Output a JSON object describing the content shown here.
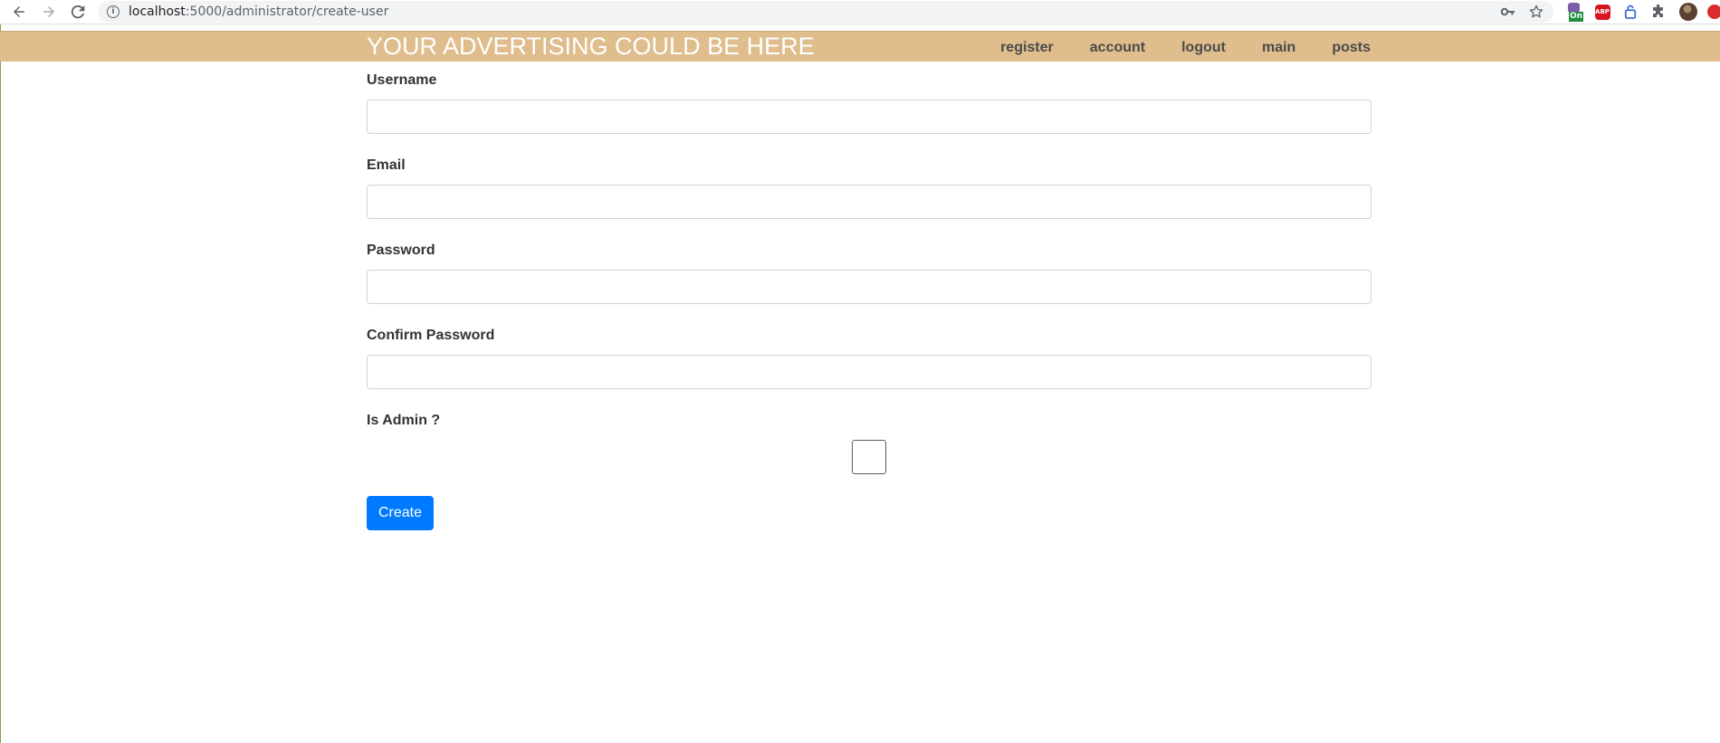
{
  "browser": {
    "url_host": "localhost",
    "url_path": ":5000/administrator/create-user",
    "extensions": {
      "on_badge": "On",
      "abp_label": "ABP"
    },
    "icons": [
      "back-arrow-icon",
      "forward-arrow-icon",
      "reload-icon",
      "info-icon",
      "key-icon",
      "star-icon",
      "puzzle-icon",
      "avatar",
      "extension-icon"
    ]
  },
  "header": {
    "brand": "YOUR ADVERTISING COULD BE HERE",
    "background_color": "#dfbd8c",
    "nav": [
      {
        "label": "register"
      },
      {
        "label": "account"
      },
      {
        "label": "logout"
      },
      {
        "label": "main"
      },
      {
        "label": "posts"
      }
    ]
  },
  "form": {
    "fields": [
      {
        "label": "Username",
        "value": "",
        "placeholder": ""
      },
      {
        "label": "Email",
        "value": "",
        "placeholder": ""
      },
      {
        "label": "Password",
        "value": "",
        "placeholder": ""
      },
      {
        "label": "Confirm Password",
        "value": "",
        "placeholder": ""
      }
    ],
    "is_admin_label": "Is Admin ?",
    "is_admin_checked": false,
    "submit_label": "Create",
    "submit_color": "#007bff"
  }
}
